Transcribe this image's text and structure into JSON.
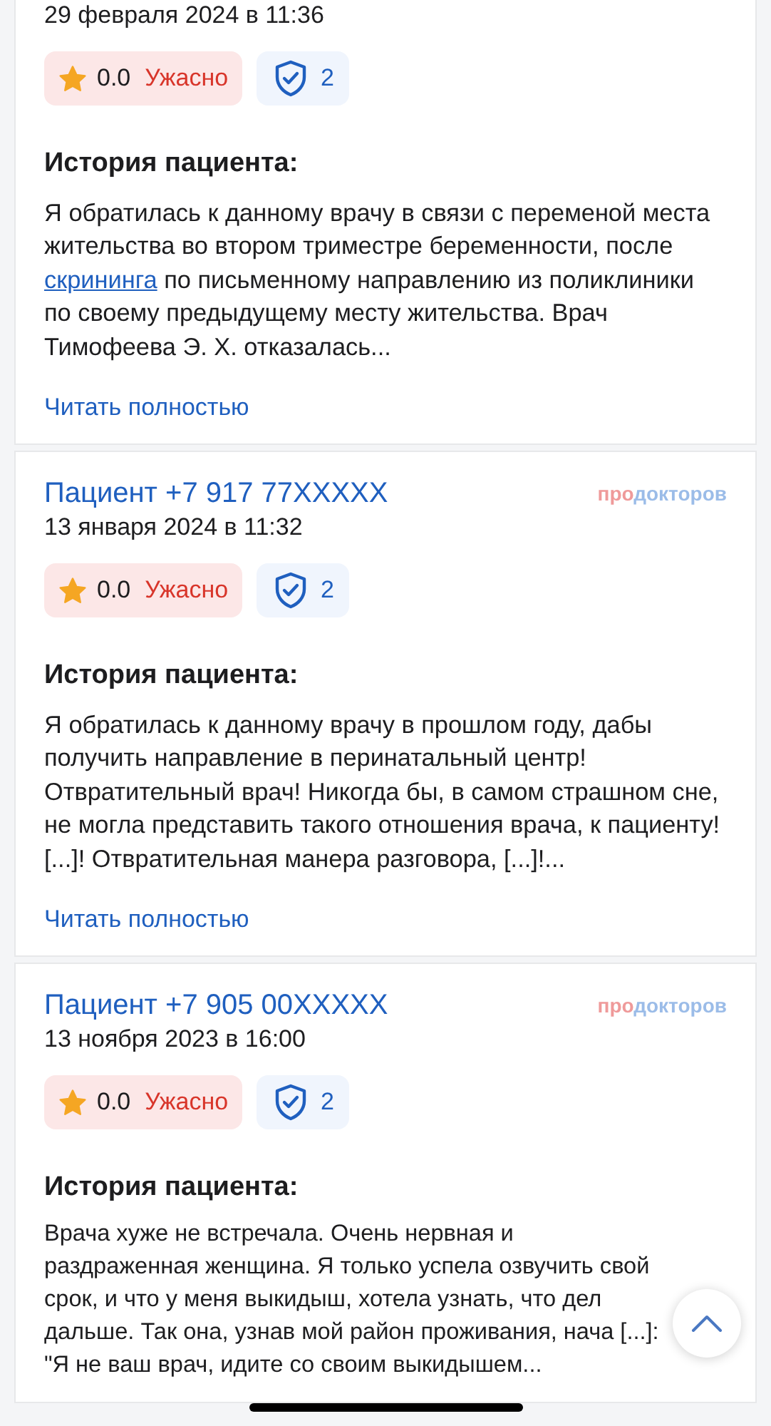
{
  "reviews": [
    {
      "date": "29 февраля 2024 в 11:36",
      "rating": {
        "score": "0.0",
        "label": "Ужасно"
      },
      "verified_count": "2",
      "story_heading": "История пациента:",
      "story": [
        {
          "kind": "text",
          "text": "Я обратилась к данному врачу в связи с переменой места жительства во втором триместре беременности, после "
        },
        {
          "kind": "link",
          "text": "скрининга"
        },
        {
          "kind": "text",
          "text": " по письменному направлению из поликлиники по своему предыдущему месту жительства. Врач Тимофеева Э. Х. отказалась..."
        }
      ],
      "read_more": "Читать полностью"
    },
    {
      "author": "Пациент +7 917 77XXXXX",
      "source_logo": {
        "prefix": "про",
        "rest": "докторов"
      },
      "date": "13 января 2024 в 11:32",
      "rating": {
        "score": "0.0",
        "label": "Ужасно"
      },
      "verified_count": "2",
      "story_heading": "История пациента:",
      "story": [
        {
          "kind": "text",
          "text": "Я обратилась к данному врачу в прошлом году, дабы получить направление в перинатальный центр! Отвратительный врач! Никогда бы, в самом страшном сне, не могла представить такого отношения врача, к пациенту! [...]! Отвратительная манера разговора, [...]!..."
        }
      ],
      "read_more": "Читать полностью"
    },
    {
      "author": "Пациент +7 905 00XXXXX",
      "source_logo": {
        "prefix": "про",
        "rest": "докторов"
      },
      "date": "13 ноября 2023 в 16:00",
      "rating": {
        "score": "0.0",
        "label": "Ужасно"
      },
      "verified_count": "2",
      "story_heading": "История пациента:",
      "story": [
        {
          "kind": "text",
          "text": "Врача хуже не встречала. Очень нервная и раздраженная женщина. Я только успела озвучить свой срок, и что у меня выкидыш, хотела узнать, что дел дальше. Так она, узнав мой район проживания, нача [...]: \"Я не ваш врач, идите со своим выкидышем..."
        }
      ]
    }
  ]
}
